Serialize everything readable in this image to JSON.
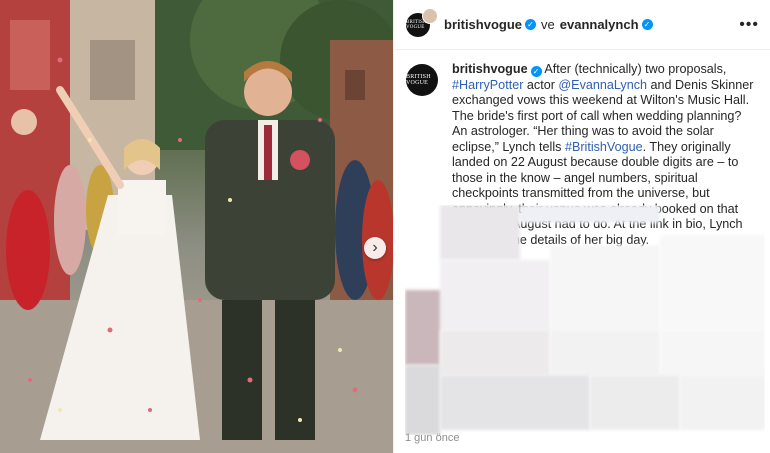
{
  "post": {
    "author": "britishvogue",
    "collab_connector": "ve",
    "collaborator": "evannalynch",
    "avatar_text": "BRITISH VOGUE",
    "more_label": "•••",
    "next_label": "›"
  },
  "caption": {
    "username": "britishvogue",
    "t1": " After (technically) two proposals, ",
    "tag1": "#HarryPotter",
    "t2": " actor ",
    "mention1": "@EvannaLynch",
    "t3": " and Denis Skinner exchanged vows this weekend at Wilton's Music Hall. The bride's first port of call when wedding planning? An astrologer. “Her thing was to avoid the solar eclipse,” Lynch tells ",
    "tag2": "#BritishVogue",
    "t4": ". They originally landed on 22 August because double digits are – to those in the know – angel numbers, spiritual checkpoints transmitted from the universe, but annoyingly, their venue was already booked on that day, so 21 August had to do. At the link in bio, Lynch shares all the details of her big day."
  },
  "footer": {
    "text": "1 gun önce"
  },
  "colors": {
    "link": "#2f5fb3",
    "verified": "#0095f6"
  }
}
